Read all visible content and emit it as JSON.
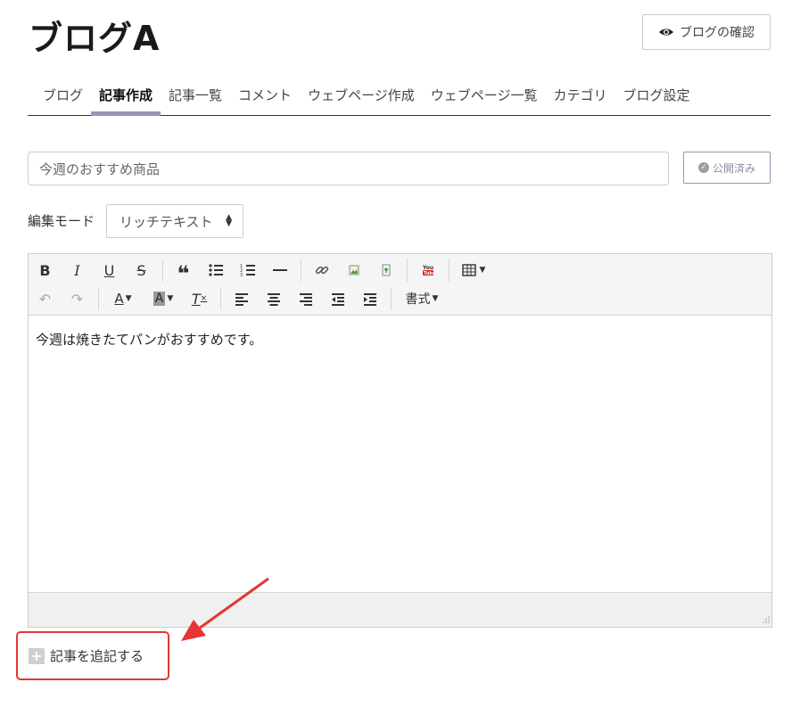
{
  "page": {
    "title": "ブログA",
    "view_button": "ブログの確認"
  },
  "tabs": [
    {
      "label": "ブログ",
      "active": false
    },
    {
      "label": "記事作成",
      "active": true
    },
    {
      "label": "記事一覧",
      "active": false
    },
    {
      "label": "コメント",
      "active": false
    },
    {
      "label": "ウェブページ作成",
      "active": false
    },
    {
      "label": "ウェブページ一覧",
      "active": false
    },
    {
      "label": "カテゴリ",
      "active": false
    },
    {
      "label": "ブログ設定",
      "active": false
    }
  ],
  "form": {
    "title_value": "今週のおすすめ商品",
    "publish_button": "公開済み",
    "mode_label": "編集モード",
    "mode_value": "リッチテキスト"
  },
  "editor": {
    "toolbar": {
      "row1": [
        "bold-icon",
        "italic-icon",
        "underline-icon",
        "strikethrough-icon",
        "blockquote-icon",
        "bulleted-list-icon",
        "numbered-list-icon",
        "horizontal-rule-icon",
        "link-icon",
        "image-icon",
        "file-upload-icon",
        "youtube-icon",
        "table-icon"
      ],
      "row2": [
        "undo-icon",
        "redo-icon",
        "text-color-icon",
        "background-color-icon",
        "clear-format-icon",
        "align-left-icon",
        "align-center-icon",
        "align-right-icon",
        "outdent-icon",
        "indent-icon"
      ],
      "format_label": "書式"
    },
    "content": "今週は焼きたてパンがおすすめです。"
  },
  "add_article": {
    "label": "記事を追記する"
  },
  "colors": {
    "accent": "#9b94b8",
    "highlight": "#e53535"
  }
}
